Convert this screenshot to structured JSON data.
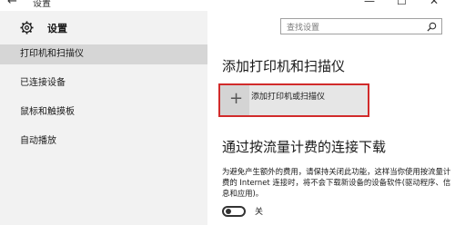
{
  "window": {
    "title": "设置",
    "back_glyph": "←",
    "minimize_glyph": "—",
    "maximize_glyph": "☐",
    "close_glyph": "✕"
  },
  "sidebar": {
    "icon": "gear-icon",
    "title": "设置",
    "items": [
      {
        "label": "打印机和扫描仪",
        "selected": true
      },
      {
        "label": "已连接设备",
        "selected": false
      },
      {
        "label": "鼠标和触摸板",
        "selected": false
      },
      {
        "label": "自动播放",
        "selected": false
      }
    ]
  },
  "search": {
    "placeholder": "查找设置",
    "icon": "search-icon"
  },
  "main": {
    "heading": "添加打印机和扫描仪",
    "add_button_glyph": "+",
    "add_button_label": "添加打印机或扫描仪",
    "metered_heading": "通过按流量计费的连接下载",
    "metered_description": "为避免产生额外的费用，请保持关闭此功能，这样当你使用按流量计费的 Internet 连接时，将不会下载新设备的设备软件(驱动程序、信息和应用)。",
    "toggle": {
      "state": "off",
      "label": "关"
    }
  },
  "colors": {
    "sidebar_bg": "#f2f2f2",
    "selected_item_bg": "#d6d6d6",
    "highlight_border": "#d12b2b"
  }
}
